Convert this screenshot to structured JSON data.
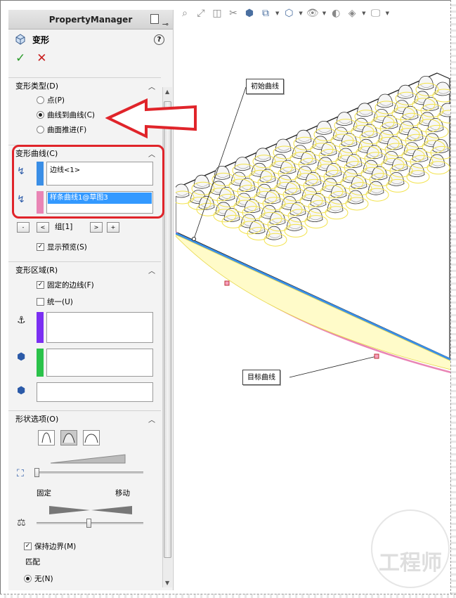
{
  "panel": {
    "title": "PropertyManager",
    "feature_name": "变形",
    "help": "?",
    "ok": "✓",
    "cancel": "✕",
    "deform_type": {
      "header": "变形类型(D)",
      "options": [
        "点(P)",
        "曲线到曲线(C)",
        "曲面推进(F)"
      ],
      "selected": "曲线到曲线(C)"
    },
    "deform_curves": {
      "header": "变形曲线(C)",
      "initial_curve": "边线<1>",
      "target_curve": "样条曲线1@草图3",
      "group_label": "组[1]",
      "nav_buttons": [
        "-",
        "<",
        ">",
        "+"
      ],
      "show_preview": "显示预览(S)",
      "initial_color": "#3a8ee6",
      "target_color": "#e985b5"
    },
    "deform_region": {
      "header": "变形区域(R)",
      "fixed_edges": "固定的边线(F)",
      "uniform": "统一(U)",
      "anchor_color": "#7b2ff2",
      "fixed_color": "#2bc24a"
    },
    "shape_options": {
      "header": "形状选项(O)",
      "label_fixed": "固定",
      "label_move": "移动",
      "keep_boundary": "保持边界(M)",
      "match": "匹配",
      "match_option": "无(N)"
    }
  },
  "viewport": {
    "callout_initial": "初始曲线",
    "callout_target": "目标曲线",
    "watermark": "工程师"
  }
}
